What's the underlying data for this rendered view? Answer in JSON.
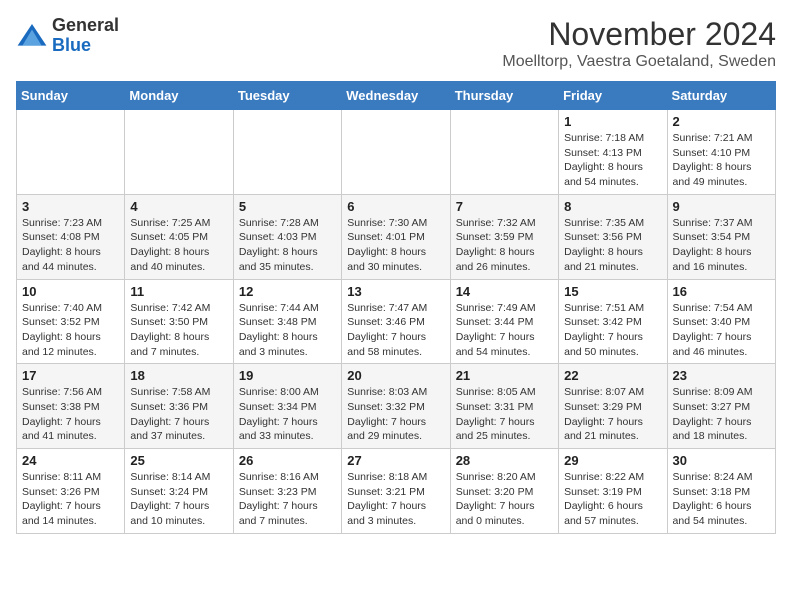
{
  "logo": {
    "line1": "General",
    "line2": "Blue"
  },
  "title": "November 2024",
  "subtitle": "Moelltorp, Vaestra Goetaland, Sweden",
  "weekdays": [
    "Sunday",
    "Monday",
    "Tuesday",
    "Wednesday",
    "Thursday",
    "Friday",
    "Saturday"
  ],
  "weeks": [
    [
      {
        "day": "",
        "info": ""
      },
      {
        "day": "",
        "info": ""
      },
      {
        "day": "",
        "info": ""
      },
      {
        "day": "",
        "info": ""
      },
      {
        "day": "",
        "info": ""
      },
      {
        "day": "1",
        "info": "Sunrise: 7:18 AM\nSunset: 4:13 PM\nDaylight: 8 hours and 54 minutes."
      },
      {
        "day": "2",
        "info": "Sunrise: 7:21 AM\nSunset: 4:10 PM\nDaylight: 8 hours and 49 minutes."
      }
    ],
    [
      {
        "day": "3",
        "info": "Sunrise: 7:23 AM\nSunset: 4:08 PM\nDaylight: 8 hours and 44 minutes."
      },
      {
        "day": "4",
        "info": "Sunrise: 7:25 AM\nSunset: 4:05 PM\nDaylight: 8 hours and 40 minutes."
      },
      {
        "day": "5",
        "info": "Sunrise: 7:28 AM\nSunset: 4:03 PM\nDaylight: 8 hours and 35 minutes."
      },
      {
        "day": "6",
        "info": "Sunrise: 7:30 AM\nSunset: 4:01 PM\nDaylight: 8 hours and 30 minutes."
      },
      {
        "day": "7",
        "info": "Sunrise: 7:32 AM\nSunset: 3:59 PM\nDaylight: 8 hours and 26 minutes."
      },
      {
        "day": "8",
        "info": "Sunrise: 7:35 AM\nSunset: 3:56 PM\nDaylight: 8 hours and 21 minutes."
      },
      {
        "day": "9",
        "info": "Sunrise: 7:37 AM\nSunset: 3:54 PM\nDaylight: 8 hours and 16 minutes."
      }
    ],
    [
      {
        "day": "10",
        "info": "Sunrise: 7:40 AM\nSunset: 3:52 PM\nDaylight: 8 hours and 12 minutes."
      },
      {
        "day": "11",
        "info": "Sunrise: 7:42 AM\nSunset: 3:50 PM\nDaylight: 8 hours and 7 minutes."
      },
      {
        "day": "12",
        "info": "Sunrise: 7:44 AM\nSunset: 3:48 PM\nDaylight: 8 hours and 3 minutes."
      },
      {
        "day": "13",
        "info": "Sunrise: 7:47 AM\nSunset: 3:46 PM\nDaylight: 7 hours and 58 minutes."
      },
      {
        "day": "14",
        "info": "Sunrise: 7:49 AM\nSunset: 3:44 PM\nDaylight: 7 hours and 54 minutes."
      },
      {
        "day": "15",
        "info": "Sunrise: 7:51 AM\nSunset: 3:42 PM\nDaylight: 7 hours and 50 minutes."
      },
      {
        "day": "16",
        "info": "Sunrise: 7:54 AM\nSunset: 3:40 PM\nDaylight: 7 hours and 46 minutes."
      }
    ],
    [
      {
        "day": "17",
        "info": "Sunrise: 7:56 AM\nSunset: 3:38 PM\nDaylight: 7 hours and 41 minutes."
      },
      {
        "day": "18",
        "info": "Sunrise: 7:58 AM\nSunset: 3:36 PM\nDaylight: 7 hours and 37 minutes."
      },
      {
        "day": "19",
        "info": "Sunrise: 8:00 AM\nSunset: 3:34 PM\nDaylight: 7 hours and 33 minutes."
      },
      {
        "day": "20",
        "info": "Sunrise: 8:03 AM\nSunset: 3:32 PM\nDaylight: 7 hours and 29 minutes."
      },
      {
        "day": "21",
        "info": "Sunrise: 8:05 AM\nSunset: 3:31 PM\nDaylight: 7 hours and 25 minutes."
      },
      {
        "day": "22",
        "info": "Sunrise: 8:07 AM\nSunset: 3:29 PM\nDaylight: 7 hours and 21 minutes."
      },
      {
        "day": "23",
        "info": "Sunrise: 8:09 AM\nSunset: 3:27 PM\nDaylight: 7 hours and 18 minutes."
      }
    ],
    [
      {
        "day": "24",
        "info": "Sunrise: 8:11 AM\nSunset: 3:26 PM\nDaylight: 7 hours and 14 minutes."
      },
      {
        "day": "25",
        "info": "Sunrise: 8:14 AM\nSunset: 3:24 PM\nDaylight: 7 hours and 10 minutes."
      },
      {
        "day": "26",
        "info": "Sunrise: 8:16 AM\nSunset: 3:23 PM\nDaylight: 7 hours and 7 minutes."
      },
      {
        "day": "27",
        "info": "Sunrise: 8:18 AM\nSunset: 3:21 PM\nDaylight: 7 hours and 3 minutes."
      },
      {
        "day": "28",
        "info": "Sunrise: 8:20 AM\nSunset: 3:20 PM\nDaylight: 7 hours and 0 minutes."
      },
      {
        "day": "29",
        "info": "Sunrise: 8:22 AM\nSunset: 3:19 PM\nDaylight: 6 hours and 57 minutes."
      },
      {
        "day": "30",
        "info": "Sunrise: 8:24 AM\nSunset: 3:18 PM\nDaylight: 6 hours and 54 minutes."
      }
    ]
  ]
}
